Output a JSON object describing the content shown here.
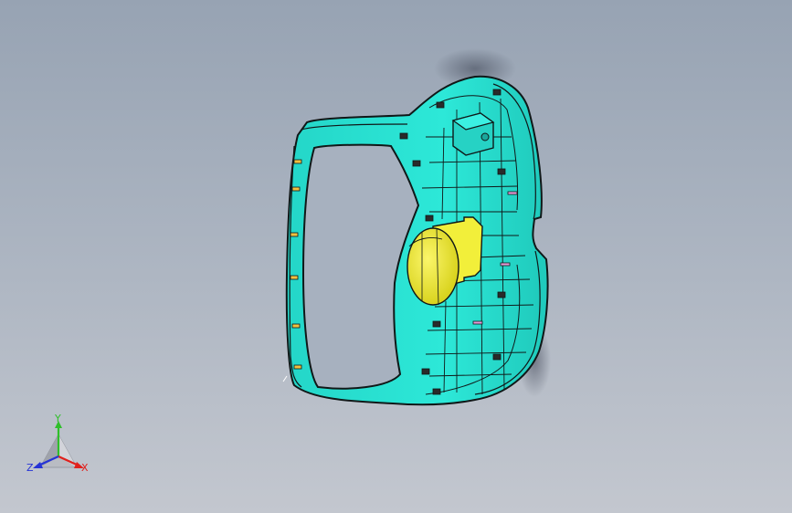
{
  "viewport": {
    "background_top": "#97a3b3",
    "background_bottom": "#c3c7cf"
  },
  "model": {
    "part_color": "#2de8d8",
    "edge_color": "#101818",
    "highlight_color": "#f2ef3a"
  },
  "triad": {
    "x_label": "X",
    "y_label": "Y",
    "z_label": "Z",
    "x_color": "#e0201c",
    "y_color": "#2fbf2a",
    "z_color": "#2533d6"
  }
}
